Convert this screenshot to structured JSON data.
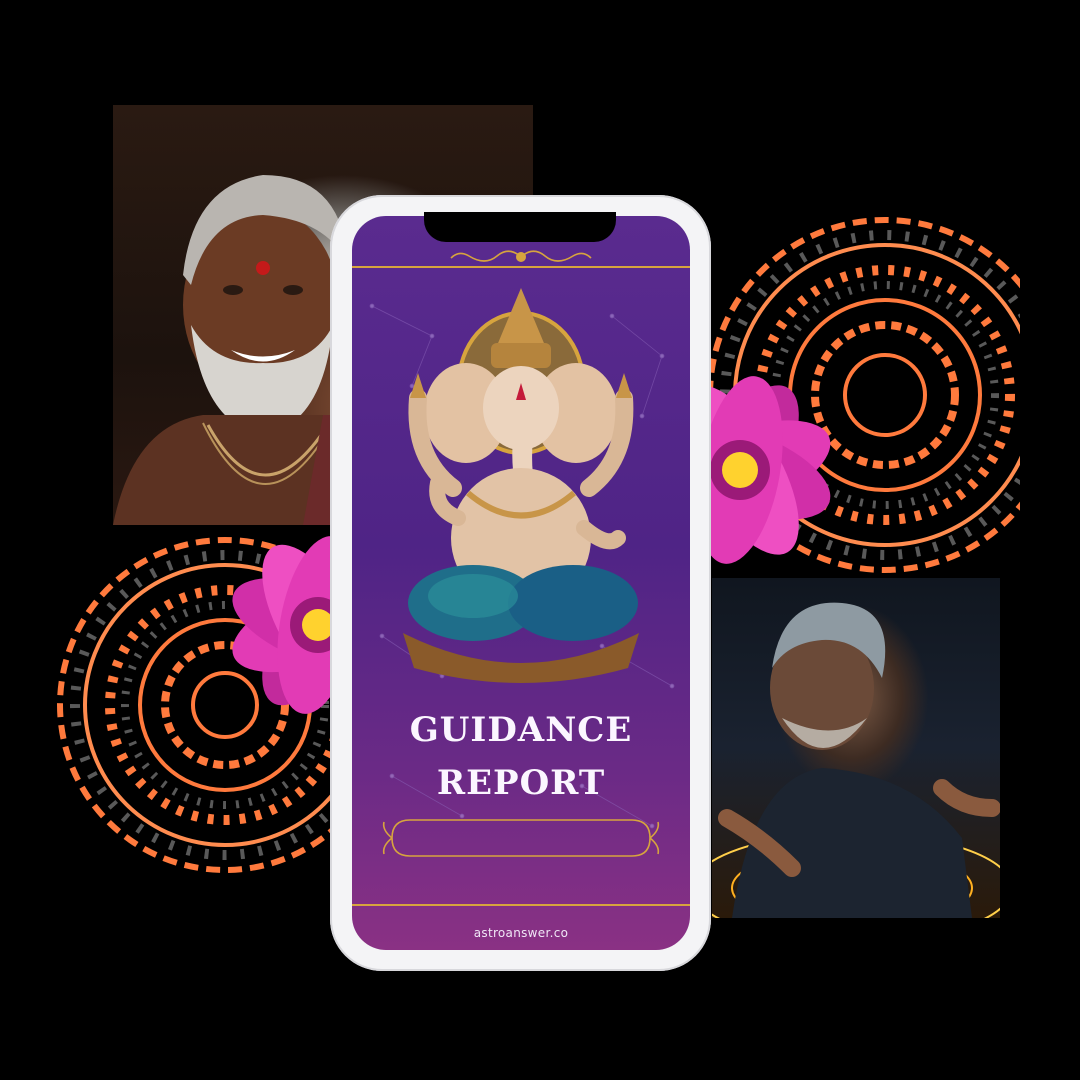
{
  "report": {
    "title_line_1": "GUIDANCE",
    "title_line_2": "REPORT",
    "website": "astroanswer.co"
  },
  "colors": {
    "screen_purple": "#5a2b8f",
    "screen_magenta": "#8a3184",
    "gold_accent": "#d7a43e",
    "mandala_orange": "#ff7a3d",
    "flower_pink": "#e23bb5",
    "phone_frame": "#f4f4f6",
    "background": "#000000"
  },
  "images": {
    "elder_portrait": "smiling-elder-portrait",
    "astrologer_photo": "astrologer-with-glowing-chart",
    "deity_illustration": "ganesha-statue",
    "decor": [
      "mandala-ornament",
      "pink-flower"
    ]
  }
}
